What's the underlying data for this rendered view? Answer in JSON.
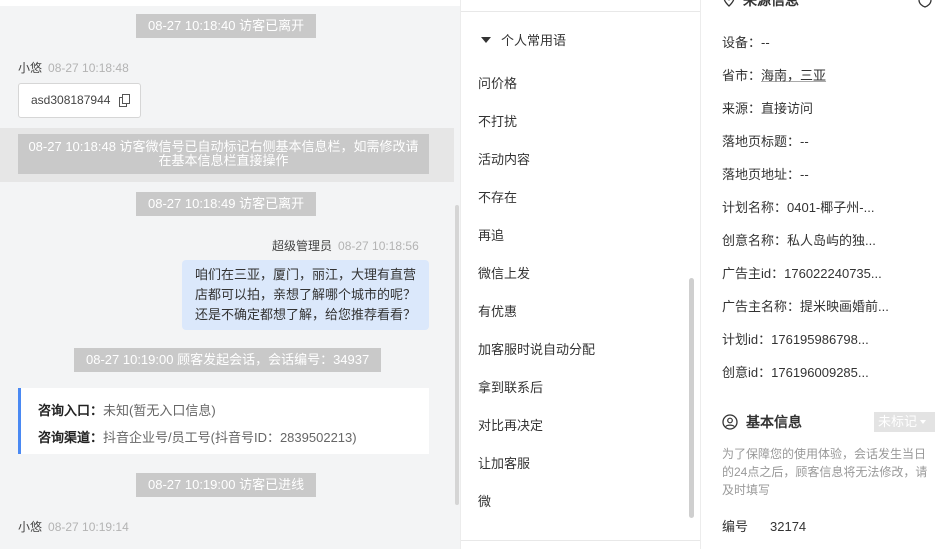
{
  "chat": {
    "sys1": "08-27 10:18:40 访客已离开",
    "msg1_name": "小悠",
    "msg1_time": "08-27 10:18:48",
    "wechat_id": "asd308187944",
    "notice_line1": "08-27 10:18:48 访客微信号已自动标记右侧基本信息栏，如需修改请",
    "notice_line2": "在基本信息栏直接操作",
    "sys2": "08-27 10:18:49 访客已离开",
    "admin_name": "超级管理员",
    "admin_time": "08-27 10:18:56",
    "bubble_lines": [
      "咱们在三亚，厦门，丽江，大理有直营",
      "店都可以拍，亲想了解哪个城市的呢？",
      "还是不确定都想了解，给您推荐看看？"
    ],
    "sys3": "08-27 10:19:00 顾客发起会话，会话编号：34937",
    "consult": {
      "entry_label": "咨询入口：",
      "entry_value": "未知(暂无入口信息)",
      "channel_label": "咨询渠道：",
      "channel_value": "抖音企业号/员工号(抖音号ID：2839502213)"
    },
    "sys4": "08-27 10:19:00 访客已进线",
    "msg2_name": "小悠",
    "msg2_time": "08-27 10:19:14"
  },
  "phrases": {
    "header": "个人常用语",
    "items": [
      "问价格",
      "不打扰",
      "活动内容",
      "不存在",
      "再追",
      "微信上发",
      "有优惠",
      "加客服时说自动分配",
      "拿到联系后",
      "对比再决定",
      "让加客服",
      "微"
    ]
  },
  "info": {
    "source_title": "来源信息",
    "rows": [
      {
        "label": "设备：",
        "value": "--"
      },
      {
        "label": "省市：",
        "value": "海南，三亚"
      },
      {
        "label": "来源：",
        "value": "直接访问"
      },
      {
        "label": "落地页标题：",
        "value": "--"
      },
      {
        "label": "落地页地址：",
        "value": "--"
      },
      {
        "label": "计划名称：",
        "value": "0401-椰子州-..."
      },
      {
        "label": "创意名称：",
        "value": "私人岛屿的独..."
      },
      {
        "label": "广告主id：",
        "value": "176022240735..."
      },
      {
        "label": "广告主名称：",
        "value": "提米映画婚前..."
      },
      {
        "label": "计划id：",
        "value": "176195986798..."
      },
      {
        "label": "创意id：",
        "value": "176196009285..."
      }
    ],
    "basic_title": "基本信息",
    "tag_select": "未标记",
    "notice": "为了保障您的使用体验，会话发生当日的24点之后，顾客信息将无法修改，请及时填写",
    "number_label": "编号",
    "number_value": "32174"
  }
}
